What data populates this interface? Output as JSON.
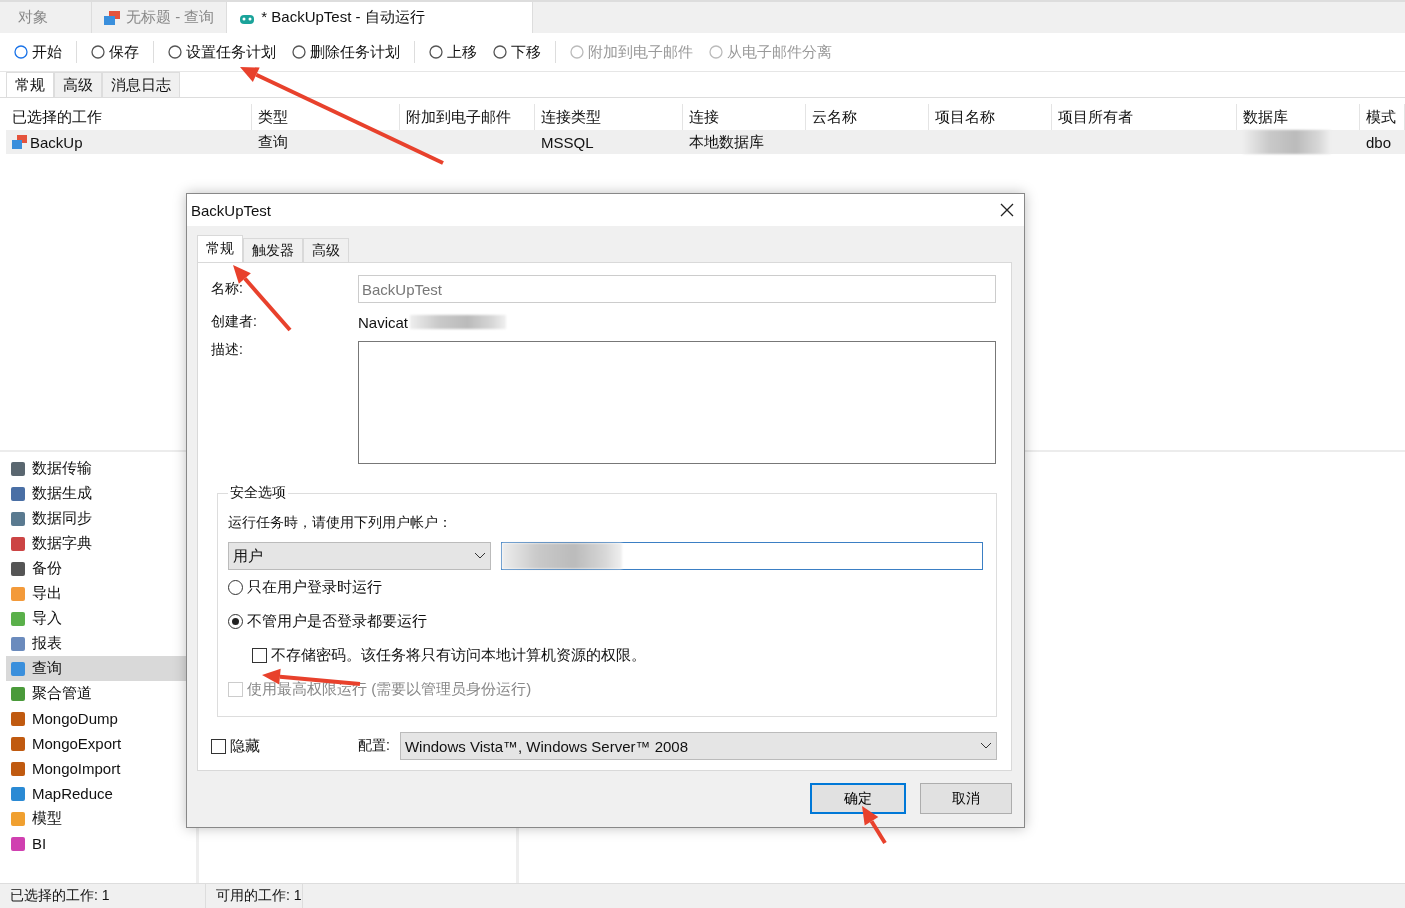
{
  "doc_tabs": [
    {
      "label": "对象",
      "selected": false,
      "kind": "plain"
    },
    {
      "label": "无标题 - 查询",
      "selected": false,
      "kind": "query"
    },
    {
      "label": "* BackUpTest - 自动运行",
      "selected": true,
      "kind": "robot"
    }
  ],
  "toolbar": [
    {
      "label": "开始",
      "disabled": false
    },
    {
      "label": "保存",
      "disabled": false
    },
    {
      "label": "设置任务计划",
      "disabled": false
    },
    {
      "label": "删除任务计划",
      "disabled": false
    },
    {
      "label": "上移",
      "disabled": false
    },
    {
      "label": "下移",
      "disabled": false
    },
    {
      "label": "附加到电子邮件",
      "disabled": true
    },
    {
      "label": "从电子邮件分离",
      "disabled": true
    }
  ],
  "sub_tabs": [
    {
      "label": "常规",
      "selected": true
    },
    {
      "label": "高级",
      "selected": false
    },
    {
      "label": "消息日志",
      "selected": false
    }
  ],
  "table": {
    "columns": [
      "已选择的工作",
      "类型",
      "附加到电子邮件",
      "连接类型",
      "连接",
      "云名称",
      "项目名称",
      "项目所有者",
      "数据库",
      "模式"
    ],
    "rows": [
      {
        "selected": true,
        "cells": [
          "BackUp",
          "查询",
          "",
          "MSSQL",
          "本地数据库",
          "",
          "",
          "",
          "",
          "dbo"
        ]
      }
    ]
  },
  "tools": [
    {
      "label": "数据传输",
      "selected": false
    },
    {
      "label": "数据生成",
      "selected": false
    },
    {
      "label": "数据同步",
      "selected": false
    },
    {
      "label": "数据字典",
      "selected": false
    },
    {
      "label": "备份",
      "selected": false
    },
    {
      "label": "导出",
      "selected": false
    },
    {
      "label": "导入",
      "selected": false
    },
    {
      "label": "报表",
      "selected": false
    },
    {
      "label": "查询",
      "selected": true
    },
    {
      "label": "聚合管道",
      "selected": false
    },
    {
      "label": "MongoDump",
      "selected": false
    },
    {
      "label": "MongoExport",
      "selected": false
    },
    {
      "label": "MongoImport",
      "selected": false
    },
    {
      "label": "MapReduce",
      "selected": false
    },
    {
      "label": "模型",
      "selected": false
    },
    {
      "label": "BI",
      "selected": false
    }
  ],
  "status_bar": [
    "已选择的工作: 1",
    "可用的工作: 1"
  ],
  "dialog": {
    "title": "BackUpTest",
    "tabs": [
      {
        "label": "常规",
        "selected": true
      },
      {
        "label": "触发器",
        "selected": false
      },
      {
        "label": "高级",
        "selected": false
      }
    ],
    "name_label": "名称:",
    "name_value": "BackUpTest",
    "creator_label": "创建者:",
    "creator_value": "Navicat",
    "description_label": "描述:",
    "security": {
      "legend": "安全选项",
      "prompt": "运行任务時，请使用下列用户帐户：",
      "account_type": "用户",
      "options": [
        {
          "label": "只在用户登录时运行",
          "selected": false
        },
        {
          "label": "不管用户是否登录都要运行",
          "selected": true
        }
      ],
      "no_password": {
        "label": "不存储密码。该任务将只有访问本地计算机资源的权限。",
        "checked": false
      },
      "highest": {
        "label": "使用最高权限运行 (需要以管理员身份运行)",
        "checked": false,
        "disabled": true
      }
    },
    "hide": {
      "label": "隐藏",
      "checked": false
    },
    "config": {
      "label": "配置:",
      "value": "Windows Vista™, Windows Server™ 2008"
    },
    "buttons": [
      {
        "label": "确定",
        "default": true
      },
      {
        "label": "取消",
        "default": false
      }
    ]
  }
}
